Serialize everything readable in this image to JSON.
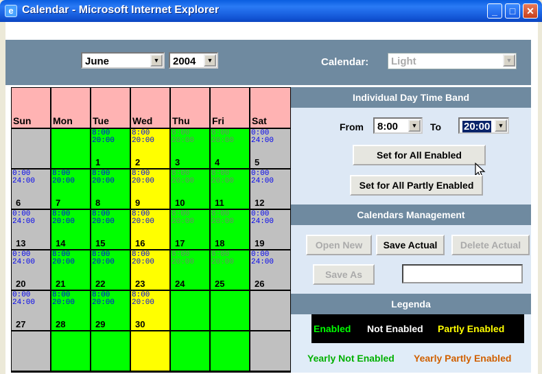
{
  "window": {
    "title": "Calendar - Microsoft Internet Explorer"
  },
  "controls": {
    "month": "June",
    "year": "2004",
    "calendar_label": "Calendar:",
    "calendar_value": "Light"
  },
  "weekdays": [
    "Sun",
    "Mon",
    "Tue",
    "Wed",
    "Thu",
    "Fri",
    "Sat"
  ],
  "weeks": [
    [
      {
        "day": "",
        "band": "",
        "color": "gray"
      },
      {
        "day": "",
        "band": "",
        "color": "green"
      },
      {
        "day": "1",
        "band": "8:00\n20:00",
        "color": "green"
      },
      {
        "day": "2",
        "band": "8:00\n20:00",
        "color": "yellow"
      },
      {
        "day": "3",
        "band": "8:00\n20:00",
        "color": "green"
      },
      {
        "day": "4",
        "band": "8:00\n20:00",
        "color": "green"
      },
      {
        "day": "5",
        "band": "0:00\n24:00",
        "color": "gray"
      }
    ],
    [
      {
        "day": "6",
        "band": "0:00\n24:00",
        "color": "gray"
      },
      {
        "day": "7",
        "band": "8:00\n20:00",
        "color": "green"
      },
      {
        "day": "8",
        "band": "8:00\n20:00",
        "color": "green"
      },
      {
        "day": "9",
        "band": "8:00\n20:00",
        "color": "yellow"
      },
      {
        "day": "10",
        "band": "8:00\n20:00",
        "color": "green"
      },
      {
        "day": "11",
        "band": "8:00\n20:00",
        "color": "green"
      },
      {
        "day": "12",
        "band": "0:00\n24:00",
        "color": "gray"
      }
    ],
    [
      {
        "day": "13",
        "band": "0:00\n24:00",
        "color": "gray"
      },
      {
        "day": "14",
        "band": "8:00\n20:00",
        "color": "green"
      },
      {
        "day": "15",
        "band": "8:00\n20:00",
        "color": "green"
      },
      {
        "day": "16",
        "band": "8:00\n20:00",
        "color": "yellow"
      },
      {
        "day": "17",
        "band": "8:00\n20:00",
        "color": "green"
      },
      {
        "day": "18",
        "band": "8:00\n20:00",
        "color": "green"
      },
      {
        "day": "19",
        "band": "0:00\n24:00",
        "color": "gray"
      }
    ],
    [
      {
        "day": "20",
        "band": "0:00\n24:00",
        "color": "gray"
      },
      {
        "day": "21",
        "band": "8:00\n20:00",
        "color": "green"
      },
      {
        "day": "22",
        "band": "8:00\n20:00",
        "color": "green"
      },
      {
        "day": "23",
        "band": "8:00\n20:00",
        "color": "yellow"
      },
      {
        "day": "24",
        "band": "8:00\n20:00",
        "color": "green"
      },
      {
        "day": "25",
        "band": "8:00\n20:00",
        "color": "green"
      },
      {
        "day": "26",
        "band": "0:00\n24:00",
        "color": "gray"
      }
    ],
    [
      {
        "day": "27",
        "band": "0:00\n24:00",
        "color": "gray"
      },
      {
        "day": "28",
        "band": "8:00\n20:00",
        "color": "green"
      },
      {
        "day": "29",
        "band": "8:00\n20:00",
        "color": "green"
      },
      {
        "day": "30",
        "band": "8:00\n20:00",
        "color": "yellow"
      },
      {
        "day": "",
        "band": "",
        "color": "green"
      },
      {
        "day": "",
        "band": "",
        "color": "green"
      },
      {
        "day": "",
        "band": "",
        "color": "gray"
      }
    ],
    [
      {
        "day": "",
        "band": "",
        "color": "gray"
      },
      {
        "day": "",
        "band": "",
        "color": "green"
      },
      {
        "day": "",
        "band": "",
        "color": "green"
      },
      {
        "day": "",
        "band": "",
        "color": "yellow"
      },
      {
        "day": "",
        "band": "",
        "color": "green"
      },
      {
        "day": "",
        "band": "",
        "color": "green"
      },
      {
        "day": "",
        "band": "",
        "color": "gray"
      }
    ]
  ],
  "time_band": {
    "header": "Individual Day Time Band",
    "from_label": "From",
    "from_value": "8:00",
    "to_label": "To",
    "to_value": "20:00",
    "set_all_enabled": "Set for All Enabled",
    "set_all_partly": "Set for All Partly Enabled"
  },
  "management": {
    "header": "Calendars Management",
    "open_new": "Open New",
    "save_actual": "Save Actual",
    "delete_actual": "Delete Actual",
    "save_as": "Save As",
    "save_as_value": ""
  },
  "legend": {
    "header": "Legenda",
    "enabled": "Enabled",
    "not_enabled": "Not Enabled",
    "partly_enabled": "Partly Enabled",
    "yearly_not_enabled": "Yearly Not Enabled",
    "yearly_partly_enabled": "Yearly Partly Enabled"
  },
  "colors": {
    "enabled": "#00ff00",
    "partly_enabled": "#ffff00",
    "not_enabled": "#c0c0c0",
    "yearly_not_enabled": "#00c000",
    "yearly_partly_enabled": "#d06000",
    "header_pink": "#ffb3b3"
  }
}
